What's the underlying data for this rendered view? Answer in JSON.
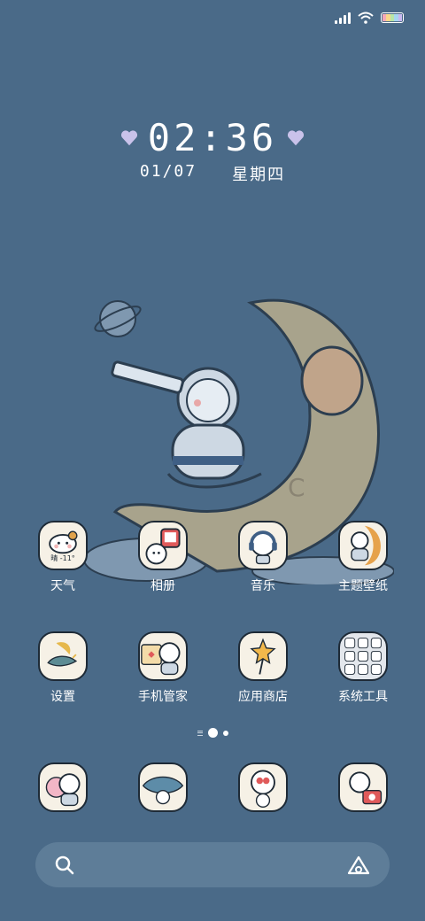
{
  "status_bar": {
    "icons": [
      "signal-icon",
      "wifi-icon",
      "battery-icon"
    ]
  },
  "lockscreen_clock": {
    "time": "02:36",
    "date": "01/07",
    "weekday": "星期四"
  },
  "home_grid": {
    "row1": [
      {
        "label": "天气",
        "icon": "weather-icon",
        "badge": "晴 -11°"
      },
      {
        "label": "相册",
        "icon": "gallery-icon"
      },
      {
        "label": "音乐",
        "icon": "music-icon"
      },
      {
        "label": "主题壁纸",
        "icon": "themes-icon"
      }
    ],
    "row2": [
      {
        "label": "设置",
        "icon": "settings-icon"
      },
      {
        "label": "手机管家",
        "icon": "security-icon"
      },
      {
        "label": "应用商店",
        "icon": "app-store-icon"
      },
      {
        "label": "系统工具",
        "icon": "system-tools-folder-icon"
      }
    ]
  },
  "page_indicator": {
    "pages": 2,
    "active": 1
  },
  "dock": [
    {
      "icon": "phone-icon"
    },
    {
      "icon": "messages-icon"
    },
    {
      "icon": "browser-icon"
    },
    {
      "icon": "camera-icon"
    }
  ],
  "search_bar": {
    "icons": [
      "search-icon",
      "assistant-icon"
    ]
  },
  "colors": {
    "background": "#4a6a88",
    "search_bar": "#5e7d98",
    "icon_bg": "#f6f1e6",
    "heart": "#c9c2ea"
  }
}
